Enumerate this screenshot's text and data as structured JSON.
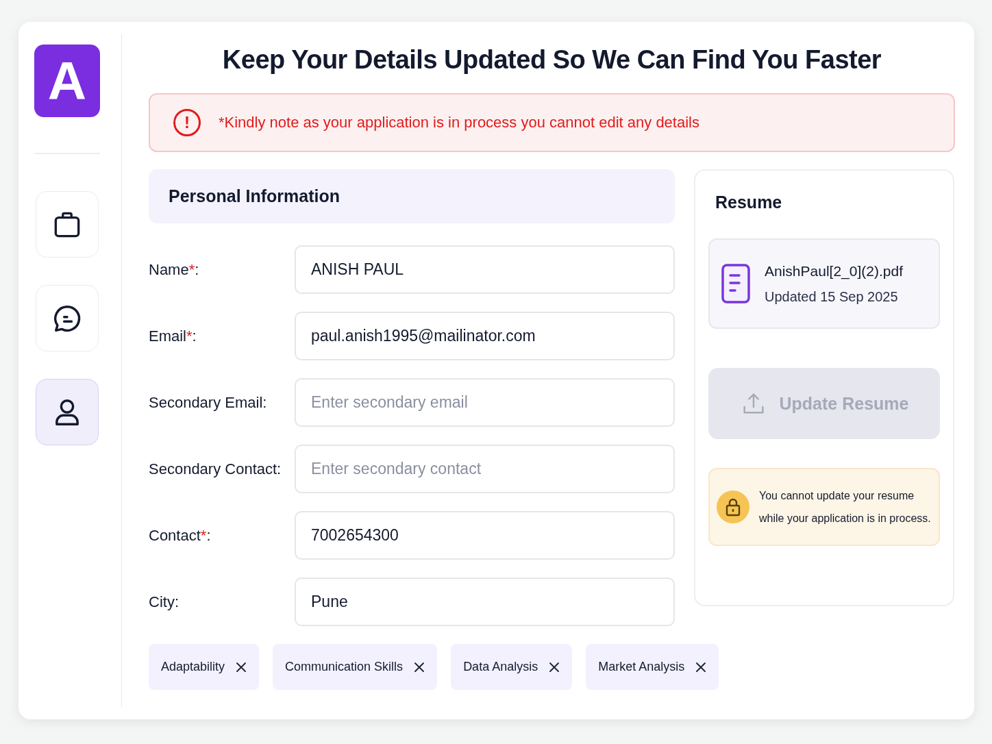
{
  "nav": {
    "logo": "A",
    "items": [
      {
        "kind": "bag",
        "selected": false
      },
      {
        "kind": "chat",
        "selected": false
      },
      {
        "kind": "user",
        "selected": true
      }
    ]
  },
  "title": "Keep Your Details Updated So We Can Find You Faster",
  "alert": {
    "icon": "!",
    "text": "*Kindly note as your application is in process you cannot edit any details"
  },
  "personal": {
    "heading": "Personal Information",
    "fields": [
      {
        "label": "Name",
        "required_mark": "*",
        "colon": ":",
        "value": "ANISH PAUL"
      },
      {
        "label": "Email",
        "required_mark": "*",
        "colon": ":",
        "value": "paul.anish1995@mailinator.com"
      },
      {
        "label": "Secondary Email",
        "colon": ":",
        "placeholder": "Enter secondary email"
      },
      {
        "label": "Secondary Contact",
        "colon": ":",
        "placeholder": "Enter secondary contact"
      },
      {
        "label": "Contact",
        "required_mark": "*",
        "colon": ":",
        "value": "7002654300"
      },
      {
        "label": "City",
        "colon": ":",
        "value": "Pune"
      }
    ]
  },
  "skills": [
    "Adaptability",
    "Communication Skills",
    "Data Analysis",
    "Market Analysis"
  ],
  "resume": {
    "heading": "Resume",
    "file_name": "AnishPaul[2_0](2).pdf",
    "updated": "Updated 15 Sep 2025",
    "button": {
      "label": "Update Resume",
      "disabled": true
    },
    "note": "You cannot update your resume while your application is in process."
  }
}
